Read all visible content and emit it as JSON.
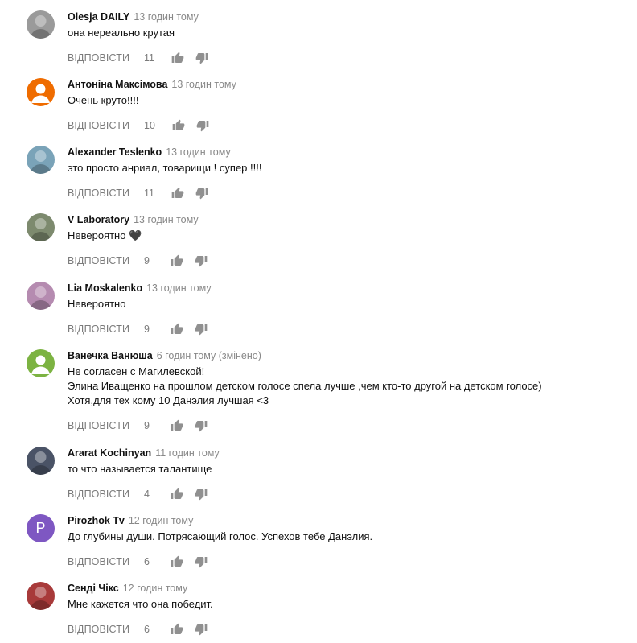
{
  "ui": {
    "reply_label": "ВІДПОВІСТИ"
  },
  "comments": [
    {
      "author": "Olesja DAILY",
      "time": "13 годин тому",
      "text": [
        "она нереально крутая"
      ],
      "likes": "11",
      "avatar": "photo",
      "avatar_color": "#9a9a9a"
    },
    {
      "author": "Антоніна Максімова",
      "time": "13 годин тому",
      "text": [
        "Очень круто!!!!"
      ],
      "likes": "10",
      "avatar": "default",
      "avatar_color": "#ef6c00"
    },
    {
      "author": "Alexander Teslenko",
      "time": "13 годин тому",
      "text": [
        "это просто анриал, товарищи ! супер !!!!"
      ],
      "likes": "11",
      "avatar": "photo",
      "avatar_color": "#7aa3b8"
    },
    {
      "author": "V Laboratory",
      "time": "13 годин тому",
      "text": [
        "Невероятно 🖤"
      ],
      "likes": "9",
      "avatar": "photo",
      "avatar_color": "#7d8a6e"
    },
    {
      "author": "Lia Moskalenko",
      "time": "13 годин тому",
      "text": [
        "Невероятно"
      ],
      "likes": "9",
      "avatar": "photo",
      "avatar_color": "#b58bb0"
    },
    {
      "author": "Ванечка Ванюша",
      "time": "6 годин тому (змінено)",
      "text": [
        "Не согласен с Магилевской!",
        "Элина Иващенко на прошлом детском голосе спела лучше ,чем кто-то другой на детском голосе)",
        "Хотя,для тех кому 10 Данэлия лучшая <3"
      ],
      "likes": "9",
      "avatar": "default",
      "avatar_color": "#7cb342"
    },
    {
      "author": "Ararat Kochinyan",
      "time": "11 годин тому",
      "text": [
        "то что называется талантище"
      ],
      "likes": "4",
      "avatar": "photo",
      "avatar_color": "#4a5366"
    },
    {
      "author": "Pirozhok Tv",
      "time": "12 годин тому",
      "text": [
        "До глубины души. Потрясающий голос. Успехов тебе Данэлия."
      ],
      "likes": "6",
      "avatar": "letter",
      "avatar_letter": "P",
      "avatar_color": "#7e57c2"
    },
    {
      "author": "Сенді Чікс",
      "time": "12 годин тому",
      "text": [
        "Мне кажется что она победит."
      ],
      "likes": "6",
      "avatar": "photo",
      "avatar_color": "#a83a3a"
    }
  ]
}
